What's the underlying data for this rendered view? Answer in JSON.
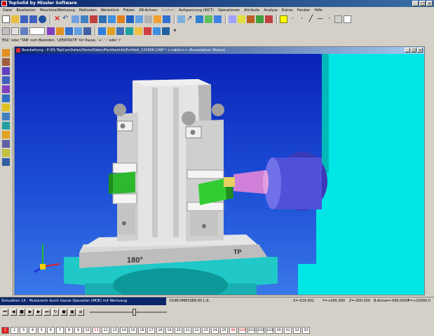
{
  "window": {
    "title": "TopSolid by Missler Software",
    "controls": [
      "_",
      "□",
      "×"
    ]
  },
  "menu": [
    "Datei",
    "Bearbeiten",
    "Maschine/Werkzeug",
    "Methoden",
    "Werkstück",
    "Fräsen",
    "KR-Achsen",
    "Drehen",
    "Aufspannung (WCT)",
    "Operationen",
    "Attribute",
    "Analyse",
    "Extras",
    "Fenster",
    "Hilfe"
  ],
  "toolbar": {
    "colorSwatch": "#ffff00"
  },
  "hint": "'ESC' oder 'TAB' zum Beenden, 'LEERTASTE' für Pause, '+', '-' oder '/'",
  "document": {
    "title": "Bearbeitung : P:/01-TopCamDaten/DemoDaten/Fachbericht/Echtteil_123456.CAM *   <<aktiv>>  (Assoziativer Modus)",
    "controls": [
      "_",
      "□",
      "×"
    ]
  },
  "scene": {
    "fixtureLabel": "180°",
    "logo": "TP"
  },
  "status": {
    "simulation": "Simulation 14 : Musterarm durch Ganze Operation (MDE) mit Werkzeug",
    "diameter": "DURCHMESSER:60  L:9.",
    "x": "X=-029.902",
    "y": "Y=+045.000",
    "z": "Z=-000.000",
    "b": "B-Achse=-090.0000",
    "f": "F=+10000.0"
  },
  "player": {
    "sliderPosition": 0.58
  },
  "steps": [
    "1",
    "2",
    "3",
    "4",
    "5",
    "6",
    "7",
    "8",
    "9",
    "10",
    "11",
    "12",
    "13",
    "14",
    "15",
    "16",
    "17",
    "18",
    "19",
    "20",
    "21",
    "22",
    "23",
    "24",
    "25",
    "99",
    "100",
    "101",
    "102",
    "103",
    "30",
    "31",
    "32",
    "33"
  ],
  "colors": {
    "titlebar": "#0a246a",
    "viewport": "#1c4ed6",
    "accent": "#00e5e5",
    "board": "#2eb82e",
    "spindle": "#4a4ad0"
  }
}
